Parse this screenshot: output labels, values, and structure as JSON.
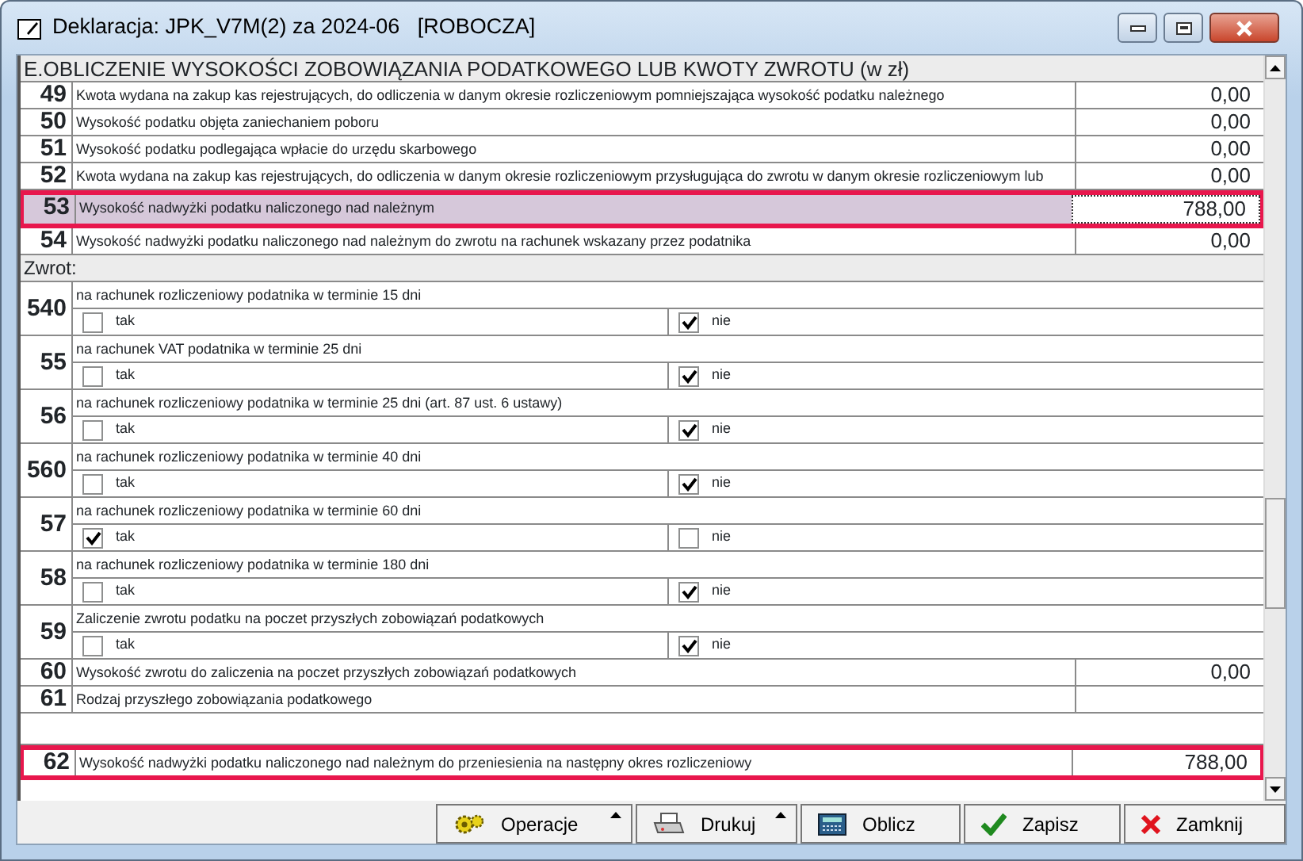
{
  "window": {
    "title": "Deklaracja: JPK_V7M(2) za 2024-06   [ROBOCZA]"
  },
  "section_header": "E.OBLICZENIE WYSOKOŚCI ZOBOWIĄZANIA PODATKOWEGO LUB KWOTY ZWROTU (w zł)",
  "rows": [
    {
      "kind": "value",
      "number": "49",
      "label": "Kwota wydana na zakup kas rejestrujących, do odliczenia w danym okresie rozliczeniowym pomniejszająca wysokość podatku należnego",
      "value": "0,00",
      "selected": false,
      "highlighted": false
    },
    {
      "kind": "value",
      "number": "50",
      "label": "Wysokość podatku objęta zaniechaniem poboru",
      "value": "0,00",
      "selected": false,
      "highlighted": false
    },
    {
      "kind": "value",
      "number": "51",
      "label": "Wysokość podatku podlegająca wpłacie do urzędu skarbowego",
      "value": "0,00",
      "selected": false,
      "highlighted": false
    },
    {
      "kind": "value",
      "number": "52",
      "label": "Kwota wydana na zakup kas rejestrujących, do odliczenia w danym okresie rozliczeniowym przysługująca do zwrotu w danym okresie rozliczeniowym lub",
      "value": "0,00",
      "selected": false,
      "highlighted": false
    },
    {
      "kind": "value",
      "number": "53",
      "label": "Wysokość nadwyżki podatku naliczonego nad należnym",
      "value": "788,00",
      "selected": true,
      "highlighted": true
    },
    {
      "kind": "value",
      "number": "54",
      "label": "Wysokość nadwyżki podatku naliczonego nad należnym do zwrotu na rachunek wskazany przez podatnika",
      "value": "0,00",
      "selected": false,
      "highlighted": false
    },
    {
      "kind": "section",
      "label": "Zwrot:"
    },
    {
      "kind": "choice",
      "number": "540",
      "label": "na rachunek rozliczeniowy podatnika w terminie 15 dni",
      "options": [
        {
          "label": "tak",
          "checked": false
        },
        {
          "label": "nie",
          "checked": true
        }
      ]
    },
    {
      "kind": "choice",
      "number": "55",
      "label": "na rachunek VAT podatnika w terminie 25 dni",
      "options": [
        {
          "label": "tak",
          "checked": false
        },
        {
          "label": "nie",
          "checked": true
        }
      ]
    },
    {
      "kind": "choice",
      "number": "56",
      "label": "na rachunek rozliczeniowy podatnika w terminie 25 dni (art. 87 ust. 6 ustawy)",
      "options": [
        {
          "label": "tak",
          "checked": false
        },
        {
          "label": "nie",
          "checked": true
        }
      ]
    },
    {
      "kind": "choice",
      "number": "560",
      "label": "na rachunek rozliczeniowy podatnika w terminie 40 dni",
      "options": [
        {
          "label": "tak",
          "checked": false
        },
        {
          "label": "nie",
          "checked": true
        }
      ]
    },
    {
      "kind": "choice",
      "number": "57",
      "label": "na rachunek rozliczeniowy podatnika w terminie 60 dni",
      "options": [
        {
          "label": "tak",
          "checked": true
        },
        {
          "label": "nie",
          "checked": false
        }
      ]
    },
    {
      "kind": "choice",
      "number": "58",
      "label": "na rachunek rozliczeniowy podatnika w terminie 180 dni",
      "options": [
        {
          "label": "tak",
          "checked": false
        },
        {
          "label": "nie",
          "checked": true
        }
      ]
    },
    {
      "kind": "choice",
      "number": "59",
      "label": "Zaliczenie zwrotu podatku na poczet przyszłych zobowiązań podatkowych",
      "options": [
        {
          "label": "tak",
          "checked": false
        },
        {
          "label": "nie",
          "checked": true
        }
      ]
    },
    {
      "kind": "value",
      "number": "60",
      "label": "Wysokość zwrotu do zaliczenia na poczet przyszłych zobowiązań podatkowych",
      "value": "0,00",
      "selected": false,
      "highlighted": false
    },
    {
      "kind": "text",
      "number": "61",
      "label": "Rodzaj przyszłego zobowiązania podatkowego"
    },
    {
      "kind": "blank"
    },
    {
      "kind": "value",
      "number": "62",
      "label": "Wysokość nadwyżki podatku naliczonego nad należnym do przeniesienia na następny okres rozliczeniowy",
      "value": "788,00",
      "selected": false,
      "highlighted": true
    }
  ],
  "buttons": [
    {
      "kind": "gears",
      "label": "Operacje",
      "menu": true
    },
    {
      "kind": "printer",
      "label": "Drukuj",
      "menu": true
    },
    {
      "kind": "calculator",
      "label": "Oblicz",
      "menu": false
    },
    {
      "kind": "check",
      "label": "Zapisz",
      "menu": false
    },
    {
      "kind": "cross",
      "label": "Zamknij",
      "menu": false
    }
  ]
}
